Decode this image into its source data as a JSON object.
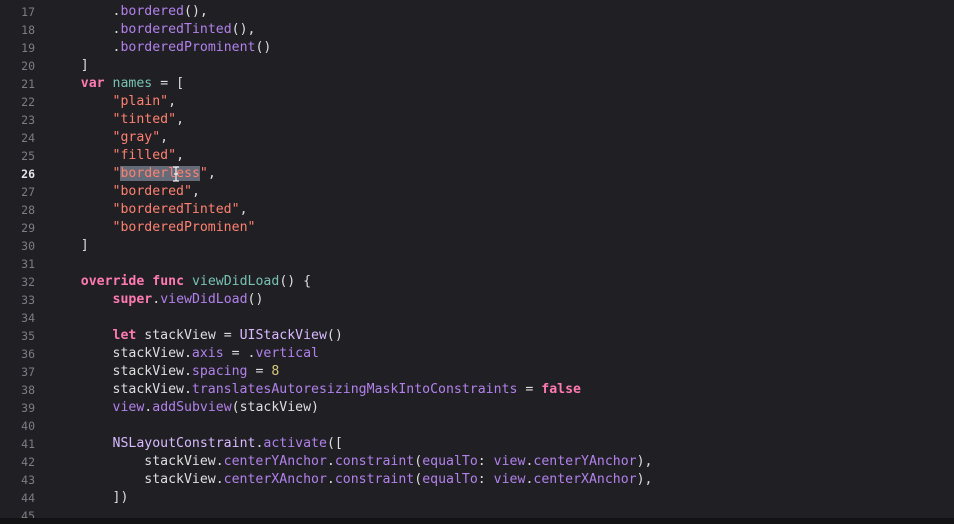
{
  "editor": {
    "current_line": "26",
    "lines": [
      {
        "num": "17",
        "tokens": [
          {
            "t": "        ",
            "c": "t-plain"
          },
          {
            "t": ".",
            "c": "t-plain"
          },
          {
            "t": "bordered",
            "c": "t-member"
          },
          {
            "t": "(),",
            "c": "t-plain"
          }
        ]
      },
      {
        "num": "18",
        "tokens": [
          {
            "t": "        ",
            "c": "t-plain"
          },
          {
            "t": ".",
            "c": "t-plain"
          },
          {
            "t": "borderedTinted",
            "c": "t-member"
          },
          {
            "t": "(),",
            "c": "t-plain"
          }
        ]
      },
      {
        "num": "19",
        "tokens": [
          {
            "t": "        ",
            "c": "t-plain"
          },
          {
            "t": ".",
            "c": "t-plain"
          },
          {
            "t": "borderedProminent",
            "c": "t-member"
          },
          {
            "t": "()",
            "c": "t-plain"
          }
        ]
      },
      {
        "num": "20",
        "tokens": [
          {
            "t": "    ]",
            "c": "t-plain"
          }
        ]
      },
      {
        "num": "21",
        "tokens": [
          {
            "t": "    ",
            "c": "t-plain"
          },
          {
            "t": "var",
            "c": "t-kw"
          },
          {
            "t": " ",
            "c": "t-plain"
          },
          {
            "t": "names",
            "c": "t-decl"
          },
          {
            "t": " = [",
            "c": "t-plain"
          }
        ]
      },
      {
        "num": "22",
        "tokens": [
          {
            "t": "        ",
            "c": "t-plain"
          },
          {
            "t": "\"plain\"",
            "c": "t-str"
          },
          {
            "t": ",",
            "c": "t-plain"
          }
        ]
      },
      {
        "num": "23",
        "tokens": [
          {
            "t": "        ",
            "c": "t-plain"
          },
          {
            "t": "\"tinted\"",
            "c": "t-str"
          },
          {
            "t": ",",
            "c": "t-plain"
          }
        ]
      },
      {
        "num": "24",
        "tokens": [
          {
            "t": "        ",
            "c": "t-plain"
          },
          {
            "t": "\"gray\"",
            "c": "t-str"
          },
          {
            "t": ",",
            "c": "t-plain"
          }
        ]
      },
      {
        "num": "25",
        "tokens": [
          {
            "t": "        ",
            "c": "t-plain"
          },
          {
            "t": "\"filled\"",
            "c": "t-str"
          },
          {
            "t": ",",
            "c": "t-plain"
          }
        ]
      },
      {
        "num": "26",
        "tokens": [
          {
            "t": "        ",
            "c": "t-plain"
          },
          {
            "t": "\"",
            "c": "t-str"
          },
          {
            "t": "borderless",
            "c": "t-sel",
            "cursor": 4
          },
          {
            "t": "\"",
            "c": "t-str"
          },
          {
            "t": ",",
            "c": "t-plain"
          }
        ]
      },
      {
        "num": "27",
        "tokens": [
          {
            "t": "        ",
            "c": "t-plain"
          },
          {
            "t": "\"bordered\"",
            "c": "t-str"
          },
          {
            "t": ",",
            "c": "t-plain"
          }
        ]
      },
      {
        "num": "28",
        "tokens": [
          {
            "t": "        ",
            "c": "t-plain"
          },
          {
            "t": "\"borderedTinted\"",
            "c": "t-str"
          },
          {
            "t": ",",
            "c": "t-plain"
          }
        ]
      },
      {
        "num": "29",
        "tokens": [
          {
            "t": "        ",
            "c": "t-plain"
          },
          {
            "t": "\"borderedProminen\"",
            "c": "t-str"
          }
        ]
      },
      {
        "num": "30",
        "tokens": [
          {
            "t": "    ]",
            "c": "t-plain"
          }
        ]
      },
      {
        "num": "31",
        "tokens": []
      },
      {
        "num": "32",
        "tokens": [
          {
            "t": "    ",
            "c": "t-plain"
          },
          {
            "t": "override",
            "c": "t-kw"
          },
          {
            "t": " ",
            "c": "t-plain"
          },
          {
            "t": "func",
            "c": "t-kw"
          },
          {
            "t": " ",
            "c": "t-plain"
          },
          {
            "t": "viewDidLoad",
            "c": "t-decl"
          },
          {
            "t": "() {",
            "c": "t-plain"
          }
        ]
      },
      {
        "num": "33",
        "tokens": [
          {
            "t": "        ",
            "c": "t-plain"
          },
          {
            "t": "super",
            "c": "t-kw"
          },
          {
            "t": ".",
            "c": "t-plain"
          },
          {
            "t": "viewDidLoad",
            "c": "t-member"
          },
          {
            "t": "()",
            "c": "t-plain"
          }
        ]
      },
      {
        "num": "34",
        "tokens": []
      },
      {
        "num": "35",
        "tokens": [
          {
            "t": "        ",
            "c": "t-plain"
          },
          {
            "t": "let",
            "c": "t-kw"
          },
          {
            "t": " stackView = ",
            "c": "t-plain"
          },
          {
            "t": "UIStackView",
            "c": "t-type"
          },
          {
            "t": "()",
            "c": "t-plain"
          }
        ]
      },
      {
        "num": "36",
        "tokens": [
          {
            "t": "        stackView.",
            "c": "t-plain"
          },
          {
            "t": "axis",
            "c": "t-member"
          },
          {
            "t": " = .",
            "c": "t-plain"
          },
          {
            "t": "vertical",
            "c": "t-member"
          }
        ]
      },
      {
        "num": "37",
        "tokens": [
          {
            "t": "        stackView.",
            "c": "t-plain"
          },
          {
            "t": "spacing",
            "c": "t-member"
          },
          {
            "t": " = ",
            "c": "t-plain"
          },
          {
            "t": "8",
            "c": "t-num"
          }
        ]
      },
      {
        "num": "38",
        "tokens": [
          {
            "t": "        stackView.",
            "c": "t-plain"
          },
          {
            "t": "translatesAutoresizingMaskIntoConstraints",
            "c": "t-member"
          },
          {
            "t": " = ",
            "c": "t-plain"
          },
          {
            "t": "false",
            "c": "t-kw"
          }
        ]
      },
      {
        "num": "39",
        "tokens": [
          {
            "t": "        ",
            "c": "t-plain"
          },
          {
            "t": "view",
            "c": "t-member"
          },
          {
            "t": ".",
            "c": "t-plain"
          },
          {
            "t": "addSubview",
            "c": "t-member"
          },
          {
            "t": "(stackView)",
            "c": "t-plain"
          }
        ]
      },
      {
        "num": "40",
        "tokens": []
      },
      {
        "num": "41",
        "tokens": [
          {
            "t": "        ",
            "c": "t-plain"
          },
          {
            "t": "NSLayoutConstraint",
            "c": "t-type"
          },
          {
            "t": ".",
            "c": "t-plain"
          },
          {
            "t": "activate",
            "c": "t-member"
          },
          {
            "t": "([",
            "c": "t-plain"
          }
        ]
      },
      {
        "num": "42",
        "tokens": [
          {
            "t": "            stackView.",
            "c": "t-plain"
          },
          {
            "t": "centerYAnchor",
            "c": "t-member"
          },
          {
            "t": ".",
            "c": "t-plain"
          },
          {
            "t": "constraint",
            "c": "t-member"
          },
          {
            "t": "(",
            "c": "t-plain"
          },
          {
            "t": "equalTo",
            "c": "t-member"
          },
          {
            "t": ": ",
            "c": "t-plain"
          },
          {
            "t": "view",
            "c": "t-member"
          },
          {
            "t": ".",
            "c": "t-plain"
          },
          {
            "t": "centerYAnchor",
            "c": "t-member"
          },
          {
            "t": "),",
            "c": "t-plain"
          }
        ]
      },
      {
        "num": "43",
        "tokens": [
          {
            "t": "            stackView.",
            "c": "t-plain"
          },
          {
            "t": "centerXAnchor",
            "c": "t-member"
          },
          {
            "t": ".",
            "c": "t-plain"
          },
          {
            "t": "constraint",
            "c": "t-member"
          },
          {
            "t": "(",
            "c": "t-plain"
          },
          {
            "t": "equalTo",
            "c": "t-member"
          },
          {
            "t": ": ",
            "c": "t-plain"
          },
          {
            "t": "view",
            "c": "t-member"
          },
          {
            "t": ".",
            "c": "t-plain"
          },
          {
            "t": "centerXAnchor",
            "c": "t-member"
          },
          {
            "t": "),",
            "c": "t-plain"
          }
        ]
      },
      {
        "num": "44",
        "tokens": [
          {
            "t": "        ])",
            "c": "t-plain"
          }
        ]
      },
      {
        "num": "45",
        "tokens": []
      }
    ]
  },
  "mouse_cursor": "i-beam-cursor-icon"
}
